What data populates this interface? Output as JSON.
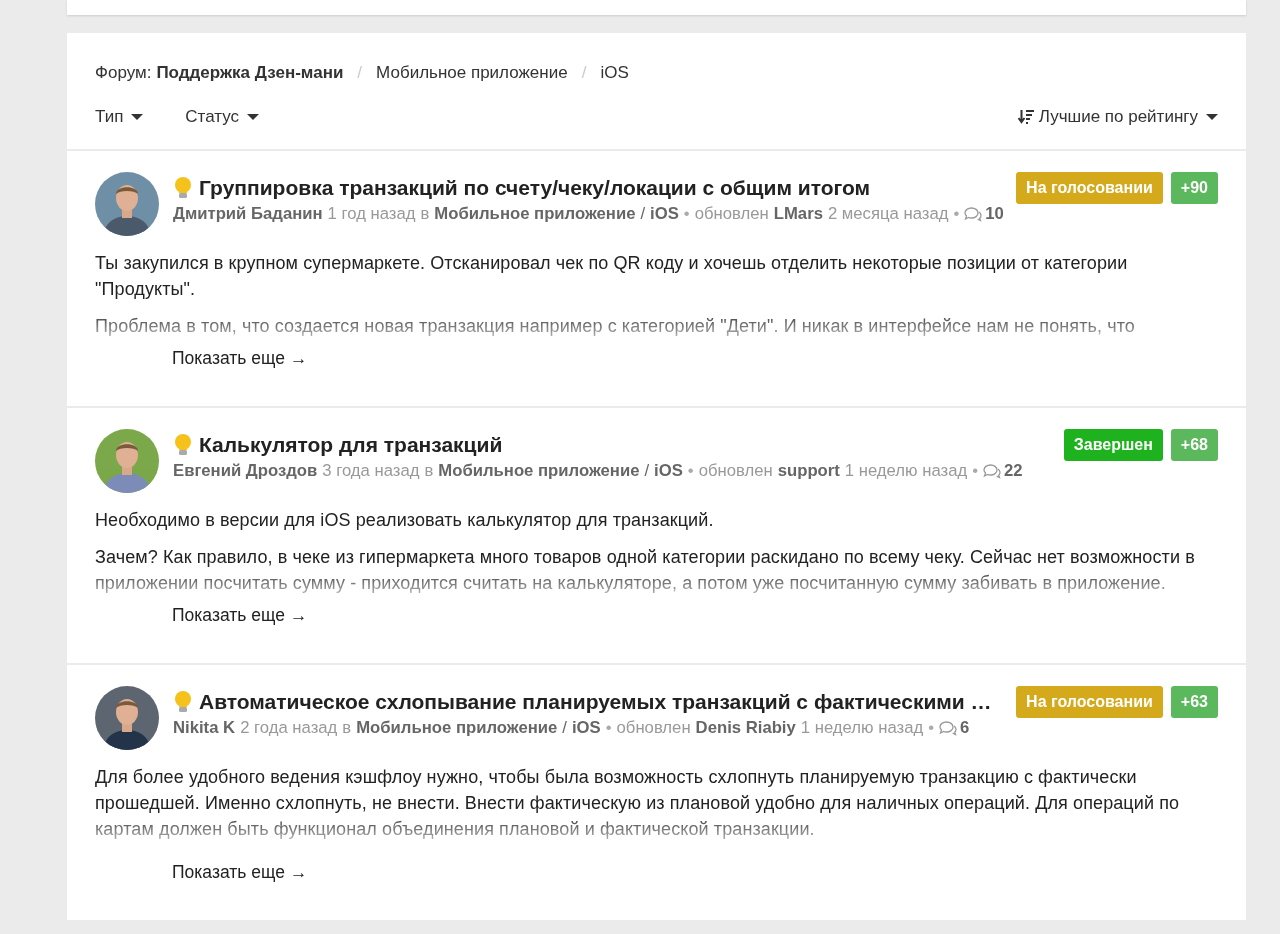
{
  "breadcrumb": {
    "label": "Форум:",
    "forum": "Поддержка Дзен-мани",
    "separators": [
      "/",
      "/"
    ],
    "items": [
      "Мобильное приложение",
      "iOS"
    ]
  },
  "filters": [
    {
      "label": "Тип"
    },
    {
      "label": "Статус"
    }
  ],
  "sort": {
    "label": "Лучшие по рейтингу"
  },
  "posts": [
    {
      "avatar": {
        "kind": "picture"
      },
      "title": "Группировка транзакций по счету/чеку/локации с общим итогом",
      "status": {
        "label": "На голосовании",
        "kind": "voting"
      },
      "score": "+90",
      "author": "Дмитрий Баданин",
      "time": "1 год назад",
      "in": "в",
      "category": "Мобильное приложение",
      "slash": "/",
      "platform": "iOS",
      "dot_1": "•",
      "updated_label": "обновлен",
      "updater": "LMars",
      "updated": "2 месяца назад",
      "dot_2": "•",
      "comments": "10",
      "paragraphs": [
        "Ты закупился в крупном супермаркете. Отсканировал чек по QR коду и хочешь отделить некоторые позиции от категории \"Продукты\".",
        "Проблема в том, что создается новая транзакция например с категорией \"Дети\". И никак в интерфейсе нам не понять, что"
      ],
      "more": "Показать еще →"
    },
    {
      "avatar": {
        "kind": "picture"
      },
      "title": "Калькулятор для транзакций",
      "status": {
        "label": "Завершен",
        "kind": "done"
      },
      "score": "+68",
      "author": "Евгений Дроздов",
      "time": "3 года назад",
      "in": "в",
      "category": "Мобильное приложение",
      "slash": "/",
      "platform": "iOS",
      "dot_1": "•",
      "updated_label": "обновлен",
      "updater": "support",
      "updated": "1 неделю назад",
      "dot_2": "•",
      "comments": "22",
      "paragraphs": [
        "Необходимо в версии для iOS реализовать калькулятор для транзакций.",
        "Зачем? Как правило, в чеке из гипермаркета много товаров одной категории раскидано по всему чеку. Сейчас нет возможности в приложении посчитать сумму - приходится считать на калькуляторе, а потом уже посчитанную сумму забивать в приложение."
      ],
      "more": "Показать еще →"
    },
    {
      "avatar": {
        "kind": "picture"
      },
      "title": "Автоматическое схлопывание планируемых транзакций с фактическими …",
      "status": {
        "label": "На голосовании",
        "kind": "voting"
      },
      "score": "+63",
      "author": "Nikita K",
      "time": "2 года назад",
      "in": "в",
      "category": "Мобильное приложение",
      "slash": "/",
      "platform": "iOS",
      "dot_1": "•",
      "updated_label": "обновлен",
      "updater": "Denis Riabiy",
      "updated": "1 неделю назад",
      "dot_2": "•",
      "comments": "6",
      "paragraphs": [
        "Для более удобного ведения кэшфлоу нужно, чтобы была возможность схлопнуть планируемую транзакцию с фактически прошедшей. Именно схлопнуть, не внести. Внести фактическую из плановой удобно для наличных операций. Для операций по картам должен быть функционал объединения плановой и фактической транзакции."
      ],
      "more": "Показать еще →"
    }
  ]
}
